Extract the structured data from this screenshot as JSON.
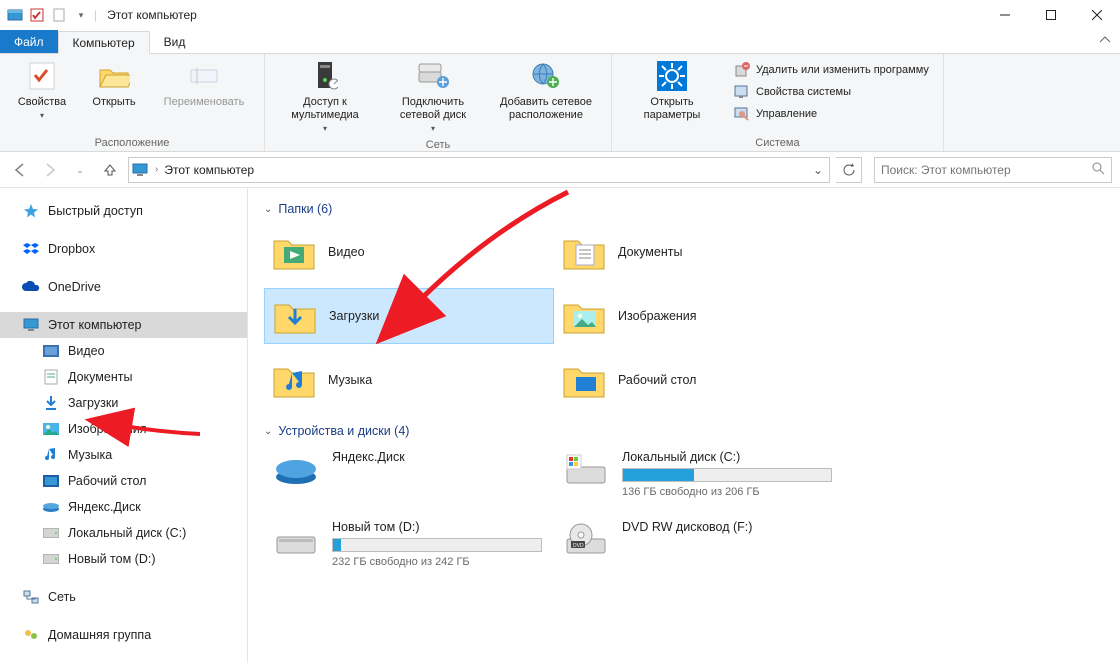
{
  "title": "Этот компьютер",
  "ribbon_tabs": {
    "file": "Файл",
    "computer": "Компьютер",
    "view": "Вид"
  },
  "ribbon": {
    "location": {
      "properties": "Свойства",
      "open": "Открыть",
      "rename": "Переименовать",
      "group": "Расположение"
    },
    "network": {
      "media": "Доступ к\nмультимедиа",
      "map": "Подключить\nсетевой диск",
      "addloc": "Добавить сетевое\nрасположение",
      "group": "Сеть"
    },
    "system": {
      "settings": "Открыть\nпараметры",
      "uninstall": "Удалить или изменить программу",
      "sysprops": "Свойства системы",
      "manage": "Управление",
      "group": "Система"
    }
  },
  "breadcrumb": {
    "root": "Этот компьютер"
  },
  "search_placeholder": "Поиск: Этот компьютер",
  "sidebar": {
    "quick": "Быстрый доступ",
    "dropbox": "Dropbox",
    "onedrive": "OneDrive",
    "thispc": "Этот компьютер",
    "video": "Видео",
    "docs": "Документы",
    "downloads": "Загрузки",
    "pictures": "Изображения",
    "music": "Музыка",
    "desktop": "Рабочий стол",
    "yadisk": "Яндекс.Диск",
    "localc": "Локальный диск (C:)",
    "newvol": "Новый том (D:)",
    "network": "Сеть",
    "homegroup": "Домашняя группа"
  },
  "content": {
    "folders_header": "Папки (6)",
    "folders": {
      "video": "Видео",
      "docs": "Документы",
      "downloads": "Загрузки",
      "pictures": "Изображения",
      "music": "Музыка",
      "desktop": "Рабочий стол"
    },
    "drives_header": "Устройства и диски (4)",
    "drives": {
      "yadisk": {
        "name": "Яндекс.Диск"
      },
      "c": {
        "name": "Локальный диск (C:)",
        "free": "136 ГБ свободно из 206 ГБ",
        "fill": 34
      },
      "d": {
        "name": "Новый том (D:)",
        "free": "232 ГБ свободно из 242 ГБ",
        "fill": 4
      },
      "dvd": {
        "name": "DVD RW дисковод (F:)"
      }
    }
  }
}
